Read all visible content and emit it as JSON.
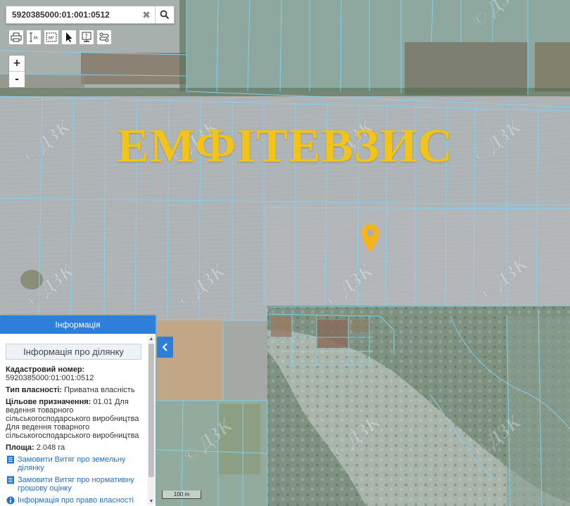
{
  "search": {
    "value": "5920385000:01:001:0512",
    "clear_icon": "close-icon",
    "search_icon": "search-icon"
  },
  "toolbar": {
    "tools": [
      "print-icon",
      "measure-distance-icon",
      "measure-area-icon",
      "pointer-icon",
      "info-icon",
      "route-icon"
    ]
  },
  "zoom": {
    "in": "+",
    "out": "-"
  },
  "overlay": {
    "title": "ЕМФІТЕВЗИС",
    "color": "#f2c318"
  },
  "watermark": "© ДЗК",
  "map": {
    "marker_color": "#f4b41a",
    "parcel_line_color": "#7fd6f5"
  },
  "panel": {
    "header": "Інформація",
    "title": "Інформація про ділянку",
    "cadastral_label": "Кадастровий номер:",
    "cadastral_value": "5920385000:01:001:0512",
    "ownership_label": "Тип власності:",
    "ownership_value": "Приватна власність",
    "purpose_label": "Цільове призначення:",
    "purpose_value": "01.01 Для ведення товарного сільськогосподарського виробництва Для ведення товарного сільськогосподарського виробництва",
    "area_label": "Площа:",
    "area_value": "2.048 га",
    "links": [
      "Замовити Витяг про земельну ділянку",
      "Замовити Витяг про нормативну грошову оцінку",
      "Інформація про право власності та"
    ]
  },
  "scale": {
    "label": "100 m"
  }
}
